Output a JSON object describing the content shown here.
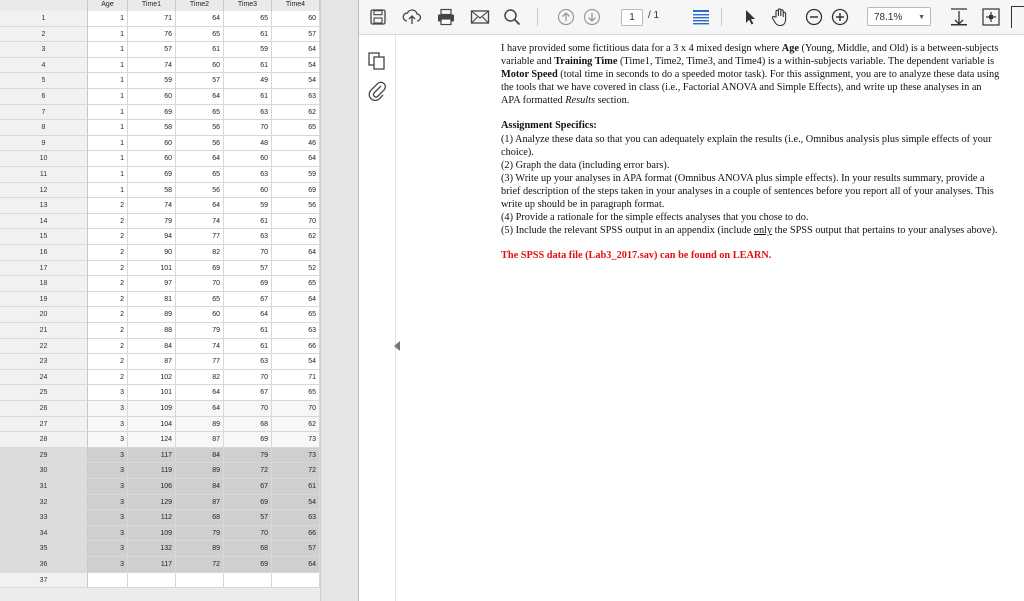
{
  "sheet": {
    "columns": [
      "Age",
      "Time1",
      "Time2",
      "Time3",
      "Time4"
    ],
    "rows": [
      [
        "1",
        "1",
        "71",
        "64",
        "65",
        "60"
      ],
      [
        "2",
        "1",
        "76",
        "65",
        "61",
        "57"
      ],
      [
        "3",
        "1",
        "57",
        "61",
        "59",
        "64"
      ],
      [
        "4",
        "1",
        "74",
        "60",
        "61",
        "54"
      ],
      [
        "5",
        "1",
        "59",
        "57",
        "49",
        "54"
      ],
      [
        "6",
        "1",
        "60",
        "64",
        "61",
        "63"
      ],
      [
        "7",
        "1",
        "69",
        "65",
        "63",
        "62"
      ],
      [
        "8",
        "1",
        "58",
        "56",
        "70",
        "65"
      ],
      [
        "9",
        "1",
        "60",
        "56",
        "48",
        "46"
      ],
      [
        "10",
        "1",
        "60",
        "64",
        "60",
        "64"
      ],
      [
        "11",
        "1",
        "69",
        "65",
        "63",
        "59"
      ],
      [
        "12",
        "1",
        "58",
        "56",
        "60",
        "69"
      ],
      [
        "13",
        "2",
        "74",
        "64",
        "59",
        "56"
      ],
      [
        "14",
        "2",
        "79",
        "74",
        "61",
        "70"
      ],
      [
        "15",
        "2",
        "94",
        "77",
        "63",
        "62"
      ],
      [
        "16",
        "2",
        "90",
        "82",
        "70",
        "64"
      ],
      [
        "17",
        "2",
        "101",
        "69",
        "57",
        "52"
      ],
      [
        "18",
        "2",
        "97",
        "70",
        "69",
        "65"
      ],
      [
        "19",
        "2",
        "81",
        "65",
        "67",
        "64"
      ],
      [
        "20",
        "2",
        "89",
        "60",
        "64",
        "65"
      ],
      [
        "21",
        "2",
        "88",
        "79",
        "61",
        "63"
      ],
      [
        "22",
        "2",
        "84",
        "74",
        "61",
        "66"
      ],
      [
        "23",
        "2",
        "87",
        "77",
        "63",
        "54"
      ],
      [
        "24",
        "2",
        "102",
        "82",
        "70",
        "71"
      ],
      [
        "25",
        "3",
        "101",
        "64",
        "67",
        "65"
      ],
      [
        "26",
        "3",
        "109",
        "64",
        "70",
        "70"
      ],
      [
        "27",
        "3",
        "104",
        "89",
        "68",
        "62"
      ],
      [
        "28",
        "3",
        "124",
        "87",
        "69",
        "73"
      ],
      [
        "29",
        "3",
        "117",
        "84",
        "79",
        "73"
      ],
      [
        "30",
        "3",
        "119",
        "89",
        "72",
        "72"
      ],
      [
        "31",
        "3",
        "106",
        "84",
        "67",
        "61"
      ],
      [
        "32",
        "3",
        "129",
        "87",
        "69",
        "54"
      ],
      [
        "33",
        "3",
        "112",
        "68",
        "57",
        "63"
      ],
      [
        "34",
        "3",
        "109",
        "79",
        "70",
        "66"
      ],
      [
        "35",
        "3",
        "132",
        "89",
        "68",
        "57"
      ],
      [
        "36",
        "3",
        "117",
        "72",
        "69",
        "64"
      ],
      [
        "37",
        "",
        "",
        "",
        "",
        ""
      ]
    ]
  },
  "pdf": {
    "toolbar": {
      "page_current": "1",
      "page_count": "/ 1",
      "zoom": "78.1%"
    },
    "icons": [
      "save-icon",
      "upload-icon",
      "print-icon",
      "email-icon",
      "search-icon",
      "prev-page-icon",
      "next-page-icon",
      "page-view-icon",
      "select-tool-icon",
      "hand-tool-icon",
      "zoom-out-icon",
      "zoom-in-icon",
      "fit-icon",
      "more-tools-icon",
      "copy-icon",
      "attachment-icon"
    ],
    "intro_1": "I have provided some fictitious data for a 3 x 4 mixed design where ",
    "intro_age": "Age",
    "intro_2": " (Young, Middle, and Old) is a between-subjects variable and ",
    "intro_tt": "Training Time",
    "intro_3": " (Time1, Time2, Time3, and Time4) is a within-subjects variable. The dependent variable is ",
    "intro_ms": "Motor Speed",
    "intro_4": " (total time in seconds to do a speeded motor task). For this assignment, you are to analyze these data using the tools that we have covered in class (i.e., Factorial ANOVA and Simple Effects), and write up these analyses in an APA formatted ",
    "intro_results": "Results",
    "intro_5": " section.",
    "specs_title": "Assignment Specifics:",
    "spec1": "(1) Analyze these data so that you can adequately explain the results (i.e., Omnibus analysis plus simple effects of your choice).",
    "spec2": "(2) Graph the data (including error bars).",
    "spec3": "(3) Write up your analyses in APA format (Omnibus ANOVA plus simple effects). In your results summary, provide a brief description of the steps taken in your analyses in a couple of sentences before you report all of your analyses. This write up should be in paragraph format.",
    "spec4": "(4) Provide a rationale for the simple effects analyses that you chose to do.",
    "spec5a": "(5) Include the relevant SPSS output in an appendix (include ",
    "spec5_only": "only",
    "spec5b": " the SPSS output that pertains to your analyses above).",
    "red_note": "The SPSS data file (Lab3_2017.sav) can be found on LEARN."
  }
}
